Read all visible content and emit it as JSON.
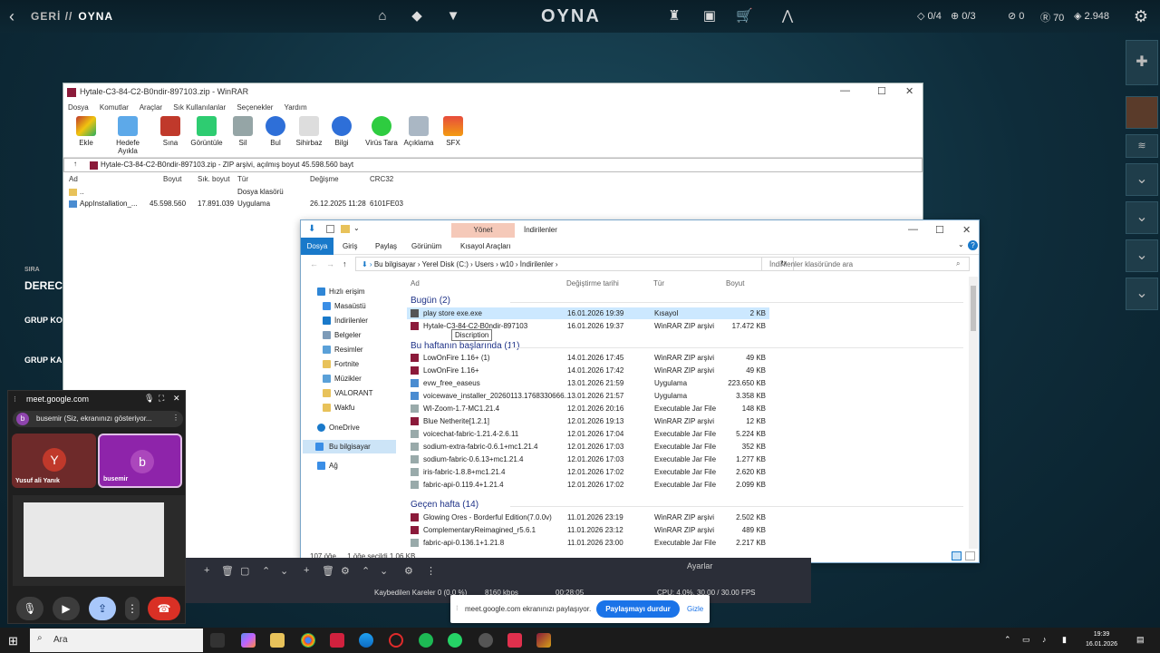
{
  "game": {
    "back_label": "GERİ",
    "separator": "//",
    "crumb": "OYNA",
    "title": "OYNA",
    "stat1": "0/4",
    "stat2": "0/3",
    "stat3": "0",
    "stat4": "70",
    "stat5": "2.948",
    "left_labels": [
      "SIRA",
      "DERECE",
      "GRUP KO",
      "GRUP KA"
    ]
  },
  "rar": {
    "title": "Hytale-C3-84-C2-B0ndir-897103.zip - WinRAR",
    "menu": [
      "Dosya",
      "Komutlar",
      "Araçlar",
      "Sık Kullanılanlar",
      "Seçenekler",
      "Yardım"
    ],
    "tools": [
      "Ekle",
      "Hedefe Ayıkla",
      "Sına",
      "Görüntüle",
      "Sil",
      "Bul",
      "Sihirbaz",
      "Bilgi",
      "Virüs Tara",
      "Açıklama",
      "SFX"
    ],
    "path": "Hytale-C3-84-C2-B0ndir-897103.zip - ZIP arşivi, açılmış boyut 45.598.560 bayt",
    "cols": [
      "Ad",
      "Boyut",
      "Sık. boyut",
      "Tür",
      "Değişme",
      "CRC32"
    ],
    "rows": [
      {
        "name": "..",
        "size": "",
        "packed": "",
        "type": "Dosya klasörü",
        "modified": "",
        "crc": ""
      },
      {
        "name": "AppInstallation_...",
        "size": "45.598.560",
        "packed": "17.891.039",
        "type": "Uygulama",
        "modified": "26.12.2025 11:28",
        "crc": "6101FE03"
      }
    ]
  },
  "explorer": {
    "manage_tab": "Yönet",
    "window_title": "İndirilenler",
    "ribbon": [
      "Dosya",
      "Giriş",
      "Paylaş",
      "Görünüm",
      "Kısayol Araçları"
    ],
    "address": [
      "Bu bilgisayar",
      "Yerel Disk (C:)",
      "Users",
      "w10",
      "İndirilenler"
    ],
    "search_placeholder": "İndirilenler klasöründe ara",
    "nav": [
      "Hızlı erişim",
      "Masaüstü",
      "İndirilenler",
      "Belgeler",
      "Resimler",
      "Fortnite",
      "Müzikler",
      "VALORANT",
      "Wakfu",
      "OneDrive",
      "Bu bilgisayar",
      "Ağ"
    ],
    "headers": [
      "Ad",
      "Değiştirme tarihi",
      "Tür",
      "Boyut"
    ],
    "groups": [
      "Bugün (2)",
      "Bu haftanın başlarında (11)",
      "Geçen hafta (14)"
    ],
    "files": [
      {
        "name": "play store exe.exe",
        "date": "16.01.2026 19:39",
        "type": "Kısayol",
        "size": "2 KB"
      },
      {
        "name": "Hytale-C3-84-C2-B0ndir-897103",
        "date": "16.01.2026 19:37",
        "type": "WinRAR ZIP arşivi",
        "size": "17.472 KB"
      },
      {
        "name": "LowOnFire 1.16+ (1)",
        "date": "14.01.2026 17:45",
        "type": "WinRAR ZIP arşivi",
        "size": "49 KB"
      },
      {
        "name": "LowOnFire 1.16+",
        "date": "14.01.2026 17:42",
        "type": "WinRAR ZIP arşivi",
        "size": "49 KB"
      },
      {
        "name": "evw_free_easeus",
        "date": "13.01.2026 21:59",
        "type": "Uygulama",
        "size": "223.650 KB"
      },
      {
        "name": "voicewave_installer_20260113.1768330666...",
        "date": "13.01.2026 21:57",
        "type": "Uygulama",
        "size": "3.358 KB"
      },
      {
        "name": "WI-Zoom-1.7-MC1.21.4",
        "date": "12.01.2026 20:16",
        "type": "Executable Jar File",
        "size": "148 KB"
      },
      {
        "name": "Blue Netherite[1.2.1]",
        "date": "12.01.2026 19:13",
        "type": "WinRAR ZIP arşivi",
        "size": "12 KB"
      },
      {
        "name": "voicechat-fabric-1.21.4-2.6.11",
        "date": "12.01.2026 17:04",
        "type": "Executable Jar File",
        "size": "5.224 KB"
      },
      {
        "name": "sodium-extra-fabric-0.6.1+mc1.21.4",
        "date": "12.01.2026 17:03",
        "type": "Executable Jar File",
        "size": "352 KB"
      },
      {
        "name": "sodium-fabric-0.6.13+mc1.21.4",
        "date": "12.01.2026 17:03",
        "type": "Executable Jar File",
        "size": "1.277 KB"
      },
      {
        "name": "iris-fabric-1.8.8+mc1.21.4",
        "date": "12.01.2026 17:02",
        "type": "Executable Jar File",
        "size": "2.620 KB"
      },
      {
        "name": "fabric-api-0.119.4+1.21.4",
        "date": "12.01.2026 17:02",
        "type": "Executable Jar File",
        "size": "2.099 KB"
      },
      {
        "name": "Glowing Ores - Borderful Edition(7.0.0v)",
        "date": "11.01.2026 23:19",
        "type": "WinRAR ZIP arşivi",
        "size": "2.502 KB"
      },
      {
        "name": "ComplementaryReimagined_r5.6.1",
        "date": "11.01.2026 23:12",
        "type": "WinRAR ZIP arşivi",
        "size": "489 KB"
      },
      {
        "name": "fabric-api-0.136.1+1.21.8",
        "date": "11.01.2026 23:00",
        "type": "Executable Jar File",
        "size": "2.217 KB"
      }
    ],
    "tooltip": "Discription",
    "status_items": "107 öğe",
    "status_selected": "1 öğe seçildi  1,06 KB"
  },
  "meet": {
    "title": "meet.google.com",
    "share_text": "busemir (Siz, ekranınızı gösteriyor...",
    "tile1_initial": "Y",
    "tile1_name": "Yusuf ali Yanık",
    "tile2_initial": "b",
    "tile2_name": "busemir"
  },
  "obs": {
    "audio": "Ayarlar",
    "frames": "Kaybedilen Kareler 0 (0,0 %)",
    "kbps": "8160 kbps",
    "time": "00:28:05",
    "cpu": "CPU: 4.0%, 30.00 / 30.00 FPS"
  },
  "share_banner": {
    "message": "meet.google.com ekranınızı paylaşıyor.",
    "stop": "Paylaşmayı durdur",
    "hide": "Gizle"
  },
  "taskbar": {
    "search": "Ara",
    "time": "19:39",
    "date": "16.01.2026"
  },
  "colors": {
    "accent": "#1979ca",
    "meet_stop": "#1a73e8",
    "end_call": "#d93025"
  }
}
